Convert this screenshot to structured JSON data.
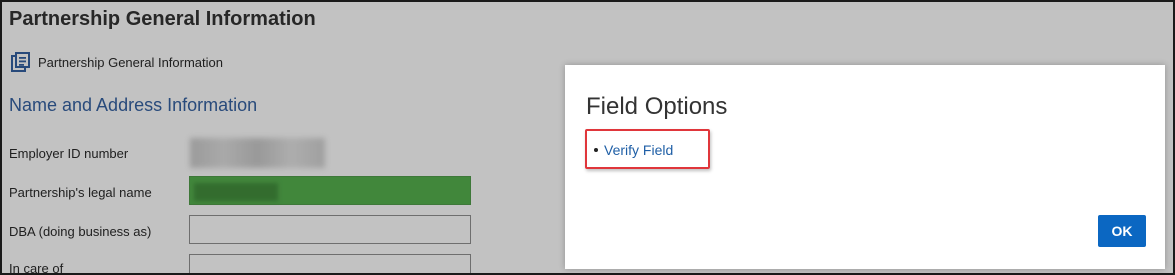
{
  "page": {
    "title": "Partnership General Information",
    "subheader": "Partnership General Information",
    "section_title": "Name and Address Information",
    "fields": [
      {
        "label": "Employer ID number"
      },
      {
        "label": "Partnership's legal name"
      },
      {
        "label": "DBA (doing business as)"
      },
      {
        "label": "In care of"
      }
    ]
  },
  "modal": {
    "title": "Field Options",
    "options": [
      "Verify Field"
    ],
    "ok_label": "OK"
  },
  "colors": {
    "accent": "#0b67c2",
    "verified_field": "#4fae47",
    "highlight": "#e0363b",
    "section_heading": "#2d5b9e"
  },
  "icons": {
    "subheader": "document-list-icon"
  }
}
